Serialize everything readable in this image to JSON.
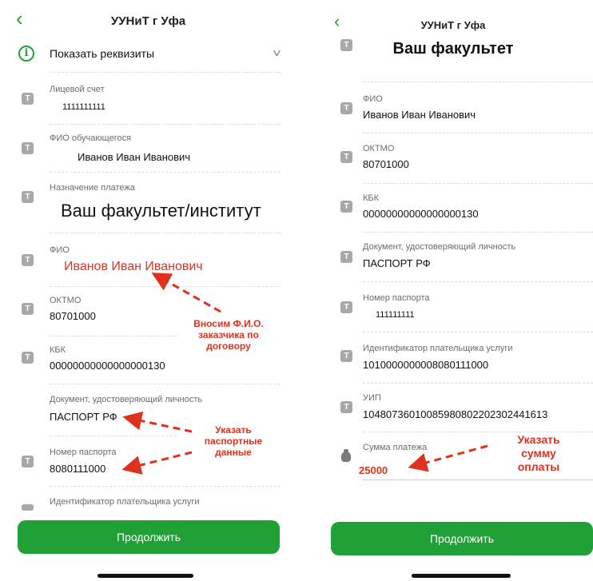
{
  "left": {
    "title": "УУНиТ г Уфа",
    "back_icon": "chevron-left-icon",
    "details_toggle": "Показать реквизиты",
    "fields": [
      {
        "label": "Лицевой счет",
        "value": "1111111111"
      },
      {
        "label": "ФИО обучающегося",
        "value": "Иванов Иван Иванович"
      },
      {
        "label": "Назначение платежа",
        "value": "Ваш факультет/институт"
      },
      {
        "label": "ФИО",
        "value": "Иванов Иван Иванович"
      },
      {
        "label": "ОКТМО",
        "value": "80701000"
      },
      {
        "label": "КБК",
        "value": "00000000000000000130"
      },
      {
        "label": "Документ, удостоверяющий личность",
        "value": "ПАСПОРТ РФ"
      },
      {
        "label": "Номер паспорта",
        "value": "8080111000"
      },
      {
        "label": "Идентификатор плательщика услуги",
        "value": ""
      }
    ],
    "annotation_fio": "Вносим Ф.И.О. заказчика по договору",
    "annotation_passport": "Указать паспортные данные",
    "continue_label": "Продолжить"
  },
  "right": {
    "title": "УУНиТ г Уфа",
    "back_icon": "chevron-left-icon",
    "faculty": "Ваш факультет",
    "fields": [
      {
        "label": "ФИО",
        "value": "Иванов Иван Иванович"
      },
      {
        "label": "ОКТМО",
        "value": "80701000"
      },
      {
        "label": "КБК",
        "value": "00000000000000000130"
      },
      {
        "label": "Документ, удостоверяющий личность",
        "value": "ПАСПОРТ РФ"
      },
      {
        "label": "Номер паспорта",
        "value": "111111111"
      },
      {
        "label": "Идентификатор плательщика услуги",
        "value": "1010000000008080111000"
      },
      {
        "label": "УИП",
        "value": "10480736010085980802202302441613"
      },
      {
        "label": "Сумма платежа",
        "value": "25000"
      }
    ],
    "annotation_amount": "Указать сумму оплаты",
    "continue_label": "Продолжить"
  },
  "colors": {
    "accent": "#21a038",
    "annotation": "#e0301e",
    "icon_gray": "#a8a8a8"
  },
  "icons": [
    "chevron-left-icon",
    "info-icon",
    "text-field-icon",
    "chevron-down-icon",
    "money-bag-icon"
  ]
}
